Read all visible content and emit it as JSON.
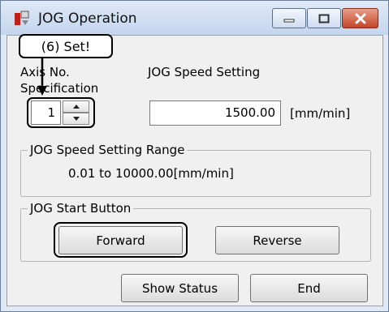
{
  "window": {
    "title": "JOG Operation"
  },
  "callout": {
    "text": "(6) Set!"
  },
  "axis": {
    "label_line1": "Axis No.",
    "label_line2": "Specification",
    "value": "1"
  },
  "speed": {
    "label": "JOG Speed Setting",
    "value": "1500.00",
    "unit": "[mm/min]"
  },
  "range_group": {
    "legend": "JOG Speed Setting Range",
    "text": "0.01 to 10000.00[mm/min]"
  },
  "start_group": {
    "legend": "JOG Start Button",
    "forward_label": "Forward",
    "reverse_label": "Reverse"
  },
  "footer": {
    "show_status_label": "Show Status",
    "end_label": "End"
  },
  "icons": {
    "app": "app-icon",
    "minimize": "minimize-icon",
    "maximize": "maximize-icon",
    "close": "close-icon",
    "spin_up": "chevron-up-icon",
    "spin_down": "chevron-down-icon",
    "arrow": "arrow-down-icon"
  },
  "colors": {
    "close_button": "#c4442a",
    "title_bar": "#c4d5ee",
    "client": "#f0f0f0"
  }
}
